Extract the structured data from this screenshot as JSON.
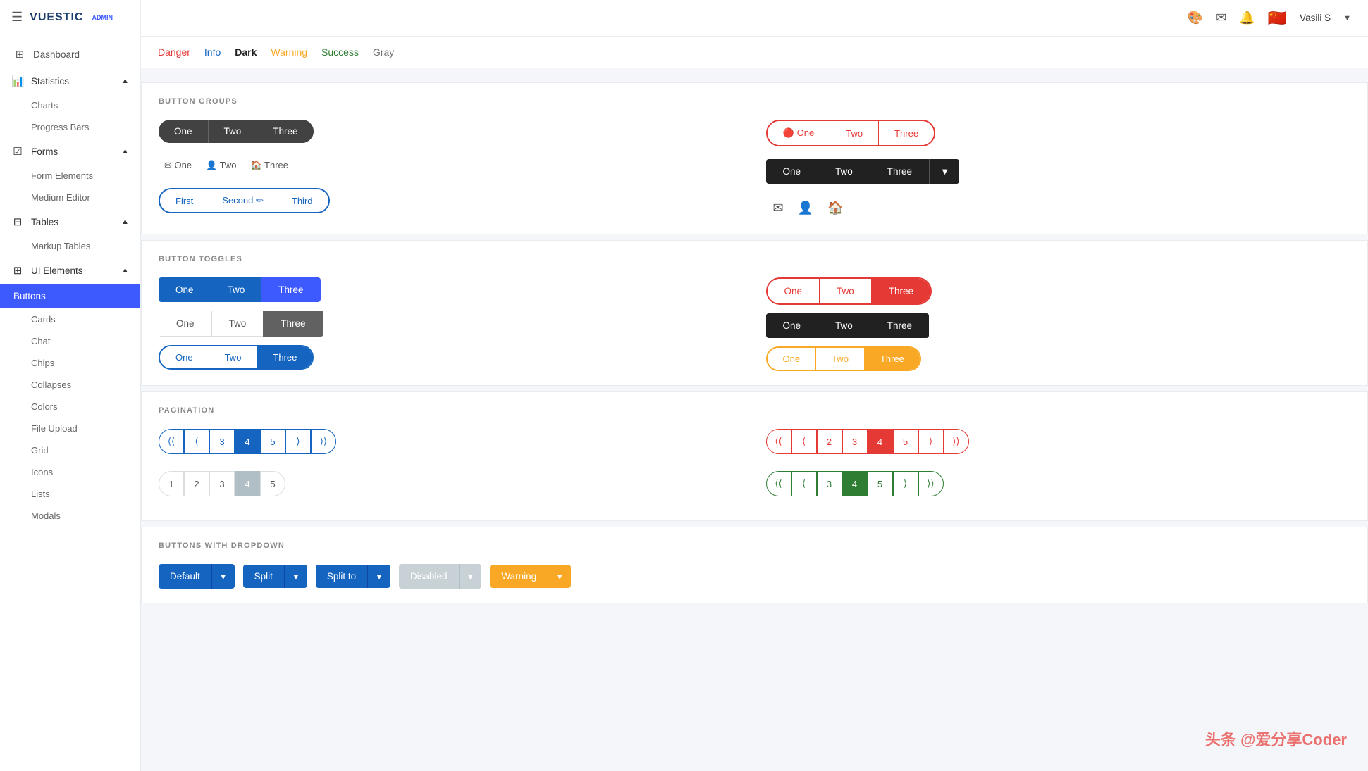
{
  "app": {
    "title": "VUESTIC",
    "admin_badge": "ADMIN",
    "user": "Vasili S"
  },
  "sidebar": {
    "items": [
      {
        "id": "dashboard",
        "label": "Dashboard",
        "icon": "⊞"
      },
      {
        "id": "statistics",
        "label": "Statistics",
        "icon": "📊",
        "has_sub": true
      },
      {
        "id": "charts",
        "label": "Charts",
        "icon": ""
      },
      {
        "id": "progress-bars",
        "label": "Progress Bars",
        "icon": ""
      },
      {
        "id": "forms",
        "label": "Forms",
        "icon": "☑",
        "has_sub": true
      },
      {
        "id": "form-elements",
        "label": "Form Elements",
        "icon": ""
      },
      {
        "id": "medium-editor",
        "label": "Medium Editor",
        "icon": ""
      },
      {
        "id": "tables",
        "label": "Tables",
        "icon": "⊟",
        "has_sub": true
      },
      {
        "id": "markup-tables",
        "label": "Markup Tables",
        "icon": ""
      },
      {
        "id": "ui-elements",
        "label": "UI Elements",
        "icon": "⊞",
        "has_sub": true
      },
      {
        "id": "buttons",
        "label": "Buttons",
        "icon": "",
        "active": true
      },
      {
        "id": "cards",
        "label": "Cards",
        "icon": ""
      },
      {
        "id": "chat",
        "label": "Chat",
        "icon": ""
      },
      {
        "id": "chips",
        "label": "Chips",
        "icon": ""
      },
      {
        "id": "collapses",
        "label": "Collapses",
        "icon": ""
      },
      {
        "id": "colors",
        "label": "Colors",
        "icon": ""
      },
      {
        "id": "file-upload",
        "label": "File Upload",
        "icon": ""
      },
      {
        "id": "grid",
        "label": "Grid",
        "icon": ""
      },
      {
        "id": "icons",
        "label": "Icons",
        "icon": ""
      },
      {
        "id": "lists",
        "label": "Lists",
        "icon": ""
      },
      {
        "id": "modals",
        "label": "Modals",
        "icon": ""
      }
    ]
  },
  "color_buttons": [
    "Danger",
    "Info",
    "Dark",
    "Warning",
    "Success",
    "Gray"
  ],
  "sections": {
    "button_groups": {
      "title": "BUTTON GROUPS",
      "left": {
        "dark_group": [
          "One",
          "Two",
          "Three"
        ],
        "icon_text_group": [
          "One",
          "Two",
          "Three"
        ],
        "outlined_pencil": [
          "First",
          "Second",
          "Third"
        ]
      },
      "right": {
        "outlined_red": [
          "One",
          "Two",
          "Three"
        ],
        "dark_chevron": [
          "One",
          "Two",
          "Three"
        ],
        "emoji_group": [
          "✉",
          "👤",
          "🏠"
        ]
      }
    },
    "button_toggles": {
      "title": "BUTTON TOGGLES",
      "left": {
        "blue": [
          "One",
          "Two",
          "Three"
        ],
        "gray_outline": [
          "One",
          "Two",
          "Three"
        ],
        "outlined_blue": [
          "One",
          "Two",
          "Three"
        ]
      },
      "right": {
        "outlined_red": [
          "One",
          "Two",
          "Three"
        ],
        "dark": [
          "One",
          "Two",
          "Three"
        ],
        "yellow": [
          "One",
          "Two",
          "Three"
        ]
      }
    },
    "pagination": {
      "title": "PAGINATION",
      "blue_pages": [
        "⟨⟨",
        "⟨",
        "3",
        "4",
        "5",
        "⟩",
        "⟩⟩"
      ],
      "plain_pages": [
        "1",
        "2",
        "3",
        "4",
        "5"
      ],
      "red_pages": [
        "⟨⟨",
        "⟨",
        "2",
        "3",
        "4",
        "5",
        "⟩",
        "⟩⟩"
      ],
      "green_pages": [
        "⟨⟨",
        "⟨",
        "3",
        "4",
        "5",
        "⟩",
        "⟩⟩"
      ]
    },
    "buttons_dropdown": {
      "title": "BUTTONS WITH DROPDOWN",
      "buttons": [
        {
          "label": "Default",
          "type": "blue",
          "has_arrow": true
        },
        {
          "label": "Split",
          "type": "blue-split",
          "has_arrow": true
        },
        {
          "label": "Split to",
          "type": "blue-split",
          "has_arrow": true
        },
        {
          "label": "Disabled",
          "type": "disabled",
          "has_arrow": true
        },
        {
          "label": "Warning",
          "type": "warning",
          "has_arrow": true
        }
      ]
    }
  },
  "watermark": "头条 @爱分享Coder"
}
